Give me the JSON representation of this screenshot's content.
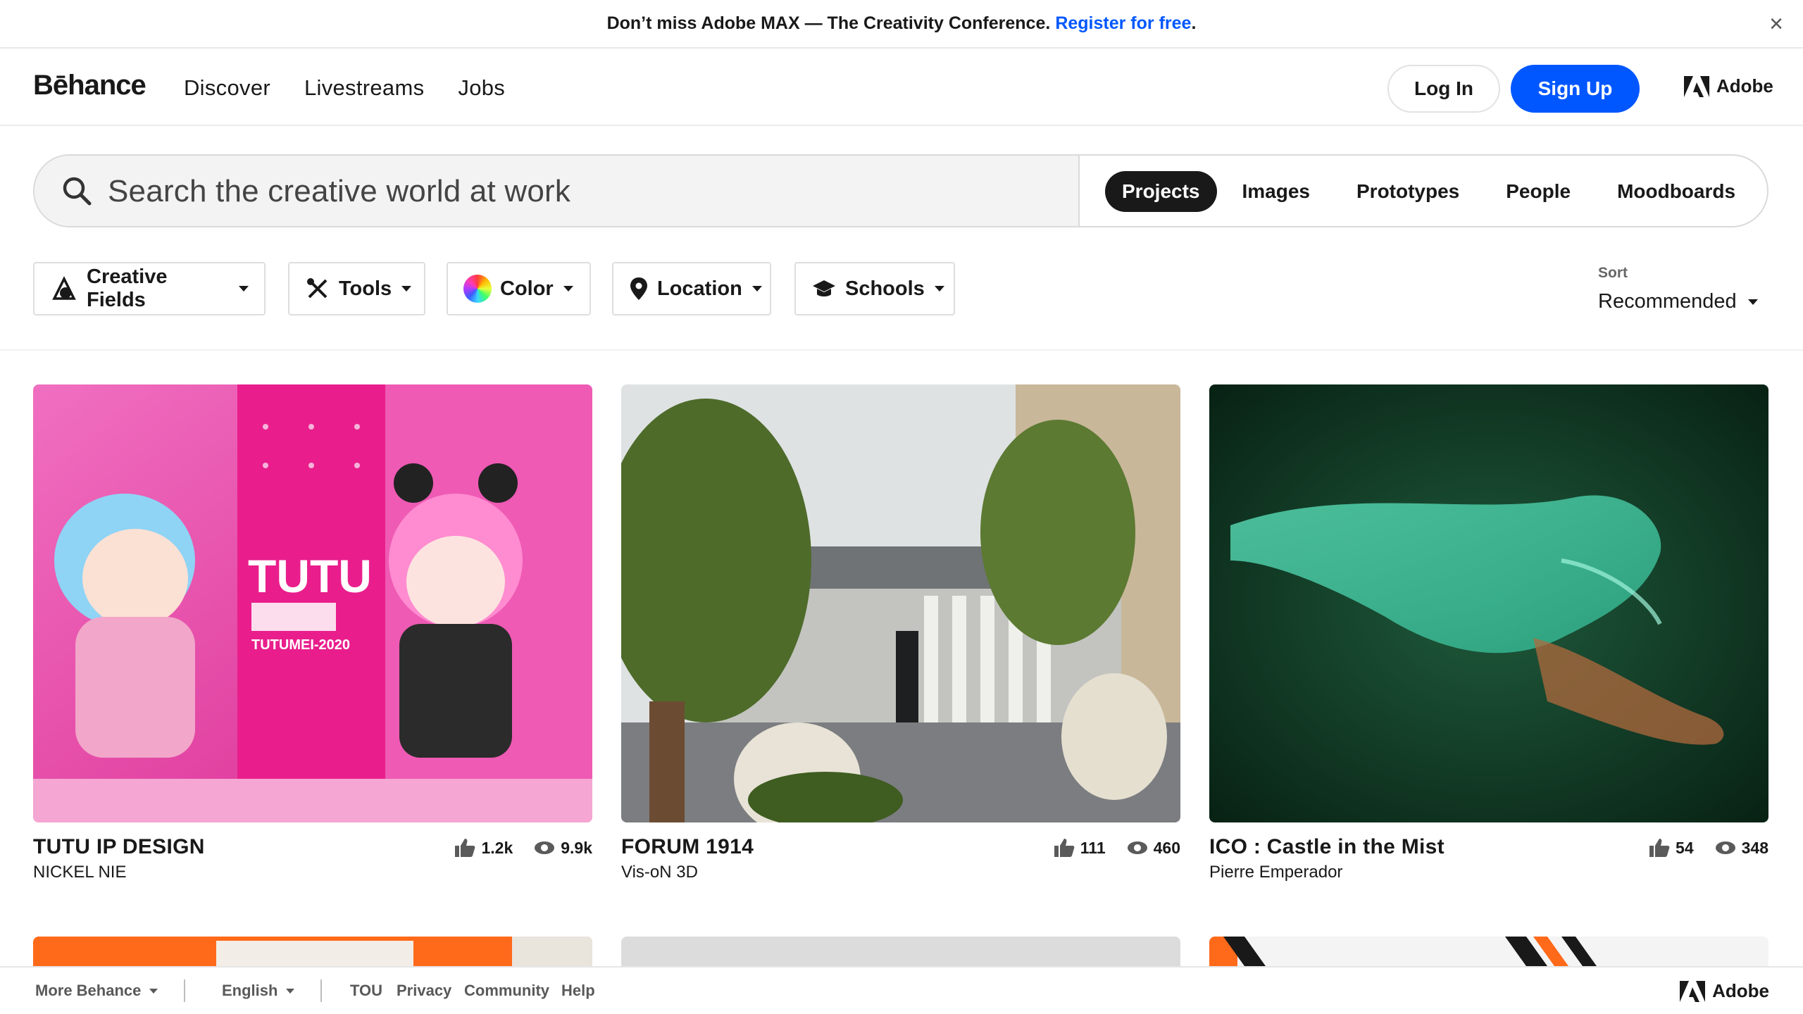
{
  "banner": {
    "text": "Don’t miss Adobe MAX — The Creativity Conference.",
    "link": "Register for free",
    "period": ".",
    "close": "×"
  },
  "header": {
    "logo": "Bēhance",
    "nav": [
      "Discover",
      "Livestreams",
      "Jobs"
    ],
    "login": "Log In",
    "signup": "Sign Up",
    "adobe": "Adobe"
  },
  "search": {
    "placeholder": "Search the creative world at work",
    "tabs": [
      "Projects",
      "Images",
      "Prototypes",
      "People",
      "Moodboards"
    ],
    "active_tab": "Projects"
  },
  "filters": {
    "creative_fields": "Creative Fields",
    "tools": "Tools",
    "color": "Color",
    "location": "Location",
    "schools": "Schools"
  },
  "sort": {
    "label": "Sort",
    "value": "Recommended"
  },
  "projects": [
    {
      "title": "TUTU IP DESIGN",
      "owner": "NICKEL NIE",
      "likes": "1.2k",
      "views": "9.9k",
      "art_text": "TUTU",
      "art_sub": "TUTUMEI-2020"
    },
    {
      "title": "FORUM 1914",
      "owner": "Vis-oN 3D",
      "likes": "111",
      "views": "460"
    },
    {
      "title": "ICO : Castle in the Mist",
      "owner": "Pierre Emperador",
      "likes": "54",
      "views": "348"
    }
  ],
  "footer": {
    "more": "More Behance",
    "language": "English",
    "links": [
      "TOU",
      "Privacy",
      "Community",
      "Help"
    ],
    "adobe": "Adobe"
  },
  "colors": {
    "accent": "#0057ff",
    "dark": "#191919"
  }
}
